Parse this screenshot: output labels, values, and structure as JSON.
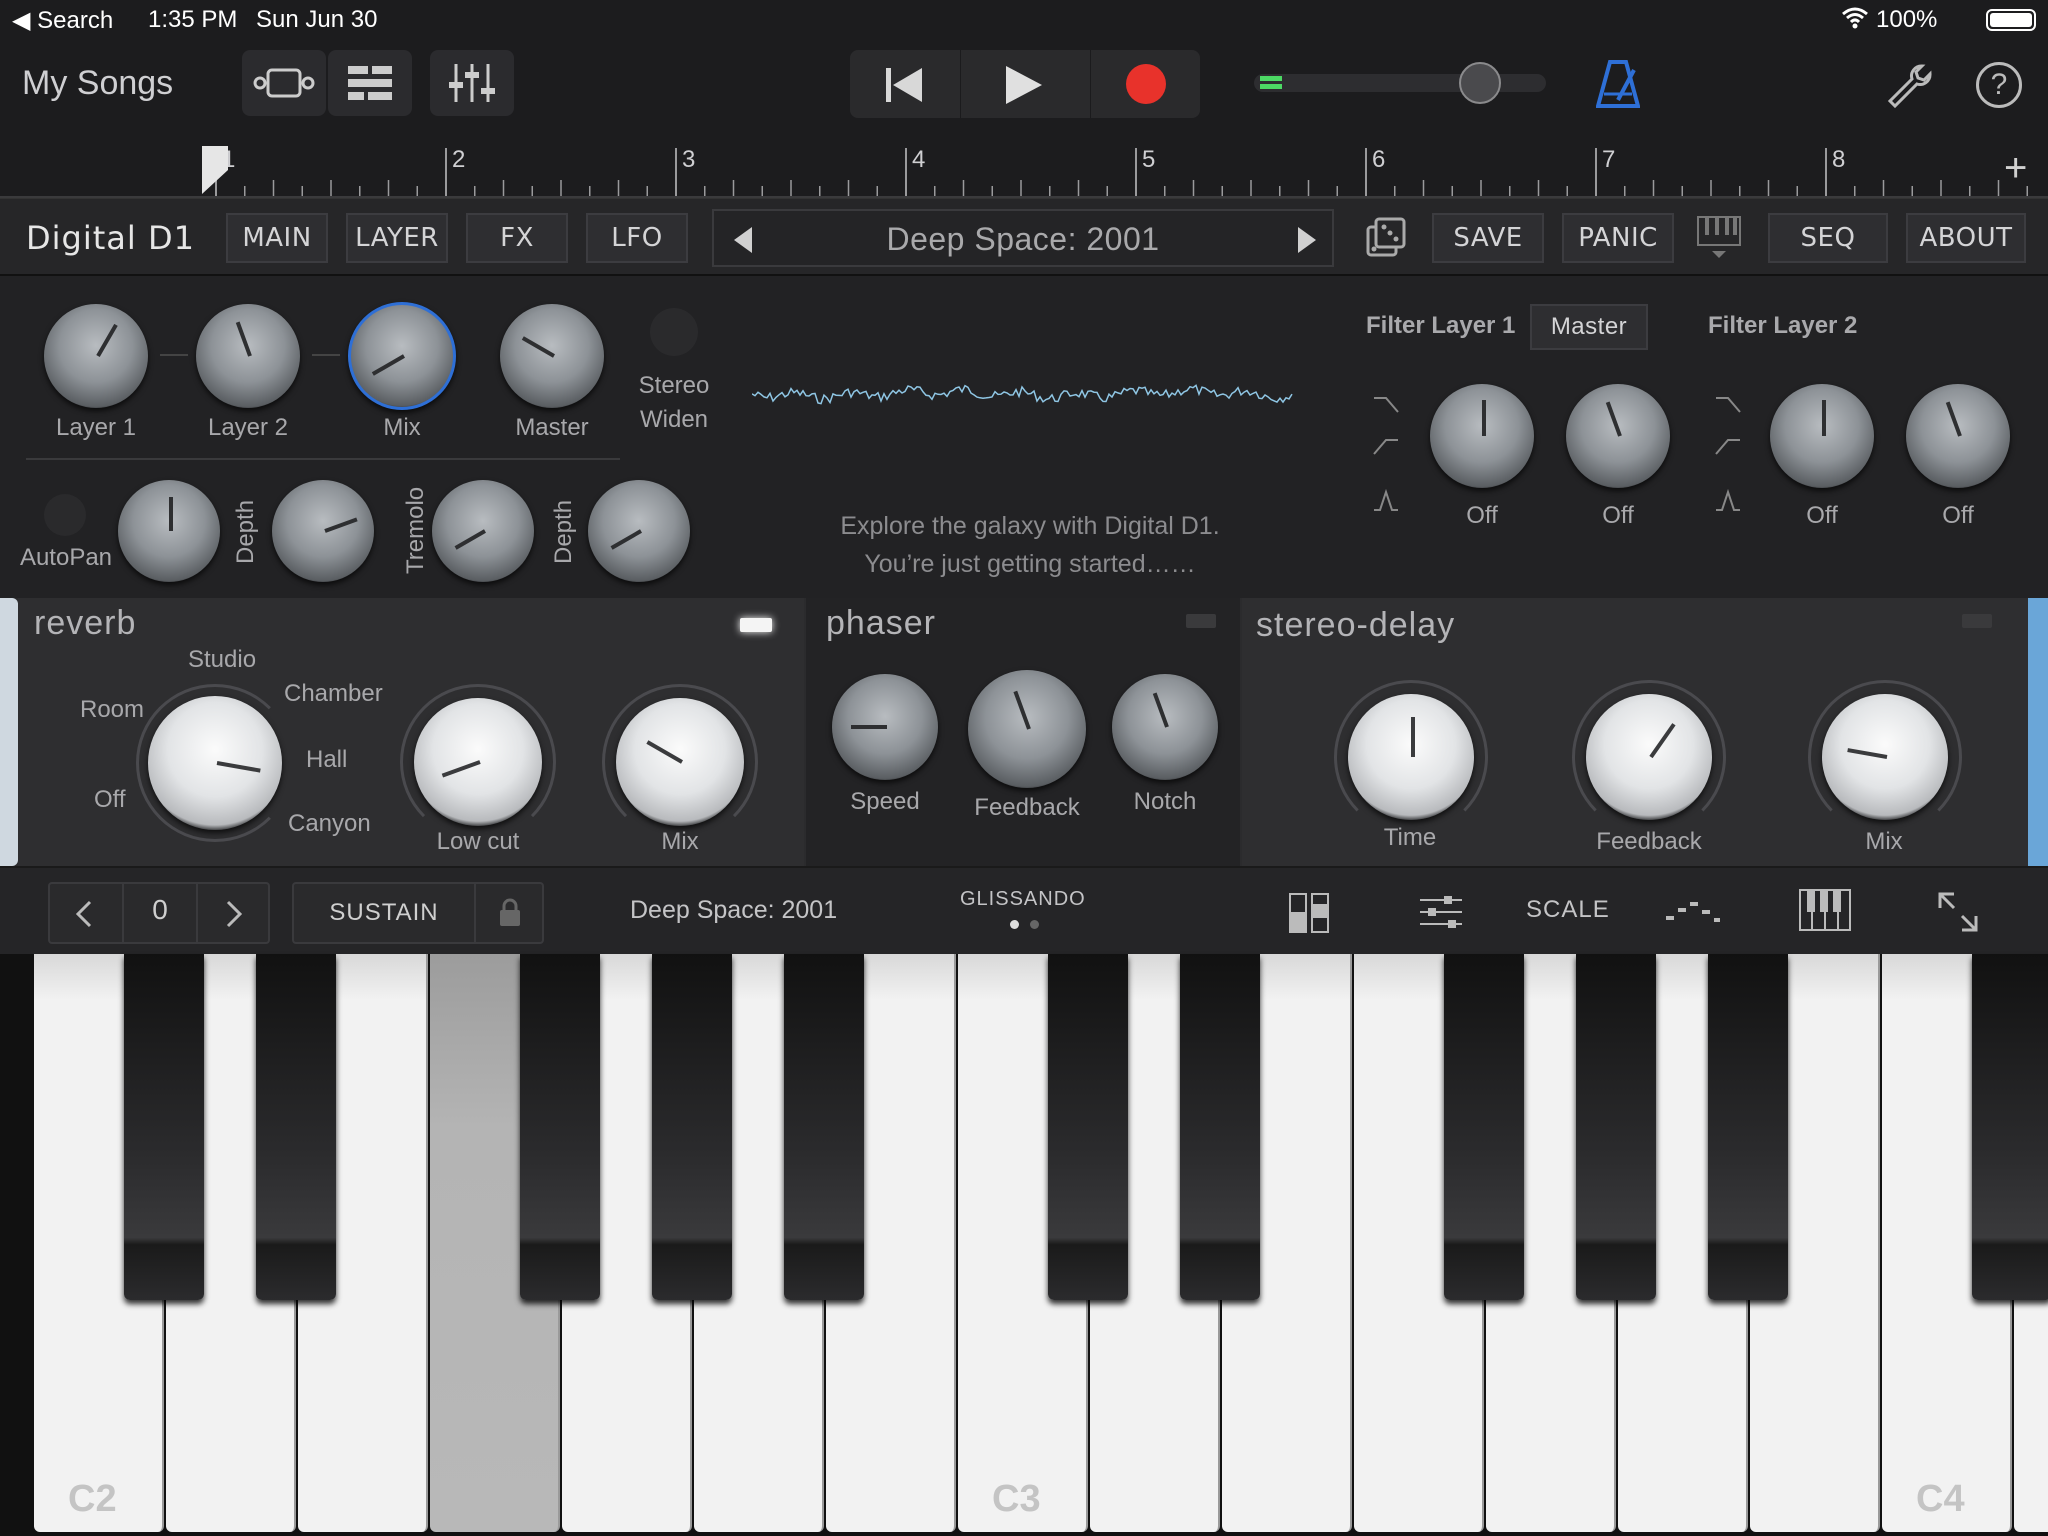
{
  "status_bar": {
    "back_label": "◀ Search",
    "time": "1:35 PM",
    "date": "Sun Jun 30",
    "battery": "100%"
  },
  "toolbar": {
    "my_songs": "My Songs"
  },
  "ruler": {
    "bars": [
      "1",
      "2",
      "3",
      "4",
      "5",
      "6",
      "7",
      "8"
    ],
    "add": "+"
  },
  "plugin": {
    "logo": "Digital D1",
    "tabs": [
      "MAIN",
      "LAYER",
      "FX",
      "LFO"
    ],
    "preset": "Deep Space: 2001",
    "buttons": {
      "save": "SAVE",
      "panic": "PANIC",
      "seq": "SEQ",
      "about": "ABOUT"
    }
  },
  "main": {
    "knobs": {
      "layer1": "Layer 1",
      "layer2": "Layer 2",
      "mix": "Mix",
      "master": "Master"
    },
    "stereo_widen": [
      "Stereo",
      "Widen"
    ],
    "autopan": "AutoPan",
    "depth": "Depth",
    "tremolo": "Tremolo",
    "message": [
      "Explore the galaxy with Digital D1.",
      "You’re just getting started……"
    ],
    "filter": {
      "layer1": "Filter Layer 1",
      "master": "Master",
      "layer2": "Filter Layer 2",
      "values": [
        "Off",
        "Off",
        "Off",
        "Off"
      ]
    }
  },
  "fx": {
    "reverb": {
      "title": "reverb",
      "room": "Room",
      "studio": "Studio",
      "chamber": "Chamber",
      "hall": "Hall",
      "canyon": "Canyon",
      "off": "Off",
      "lowcut": "Low cut",
      "mix": "Mix"
    },
    "phaser": {
      "title": "phaser",
      "speed": "Speed",
      "feedback": "Feedback",
      "notch": "Notch"
    },
    "delay": {
      "title": "stereo-delay",
      "time": "Time",
      "feedback": "Feedback",
      "mix": "Mix"
    }
  },
  "kbbar": {
    "octave": "0",
    "sustain": "SUSTAIN",
    "preset": "Deep Space: 2001",
    "glissando": "GLISSANDO",
    "scale": "SCALE"
  },
  "keyboard": {
    "labels": [
      "C2",
      "C3",
      "C4"
    ]
  },
  "colors": {
    "record": "#e8322b",
    "accent": "#2e6fd6",
    "level": "#4cd964"
  }
}
